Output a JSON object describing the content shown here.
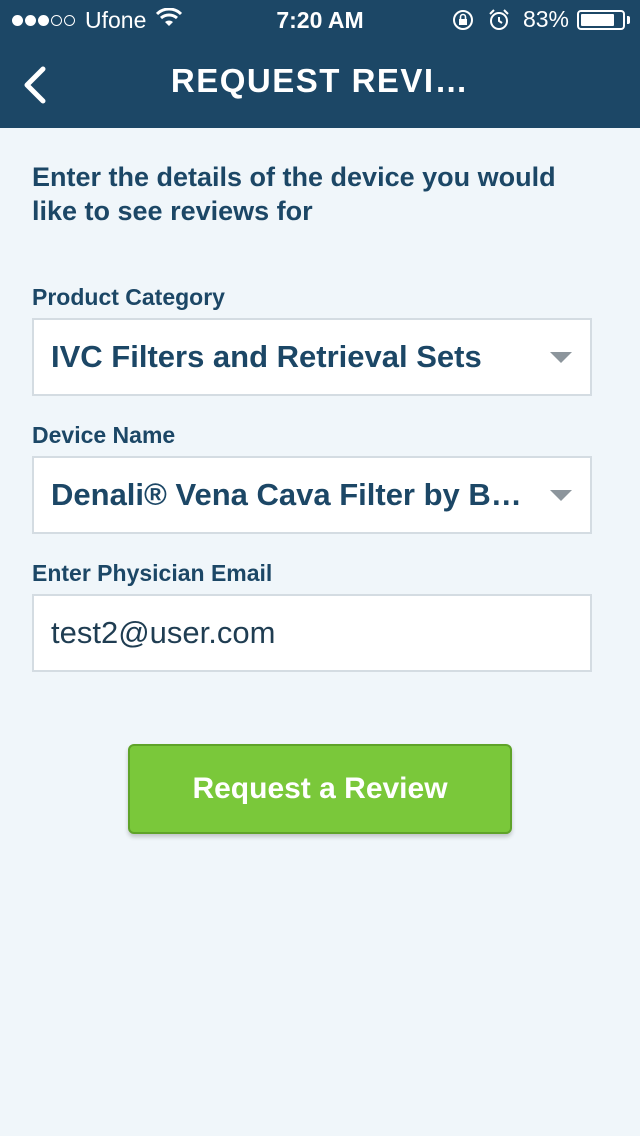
{
  "status_bar": {
    "carrier": "Ufone",
    "time": "7:20 AM",
    "battery": "83%",
    "battery_level": 0.83,
    "signal_bars_filled": 3,
    "signal_bars_total": 5
  },
  "nav": {
    "title": "REQUEST REVI…",
    "back_icon": "chevron-left-icon"
  },
  "intro_text": "Enter the details of the device you would like to see reviews for",
  "form": {
    "category_label": "Product Category",
    "category_value": "IVC Filters and Retrieval Sets",
    "device_label": "Device Name",
    "device_value": "Denali® Vena Cava Filter by B…",
    "email_label": "Enter Physician Email",
    "email_value": "test2@user.com"
  },
  "submit_label": "Request a Review",
  "colors": {
    "header_bg": "#1c4766",
    "page_bg": "#f0f6fa",
    "accent_green": "#7ac83a",
    "text_primary": "#1c4766"
  }
}
